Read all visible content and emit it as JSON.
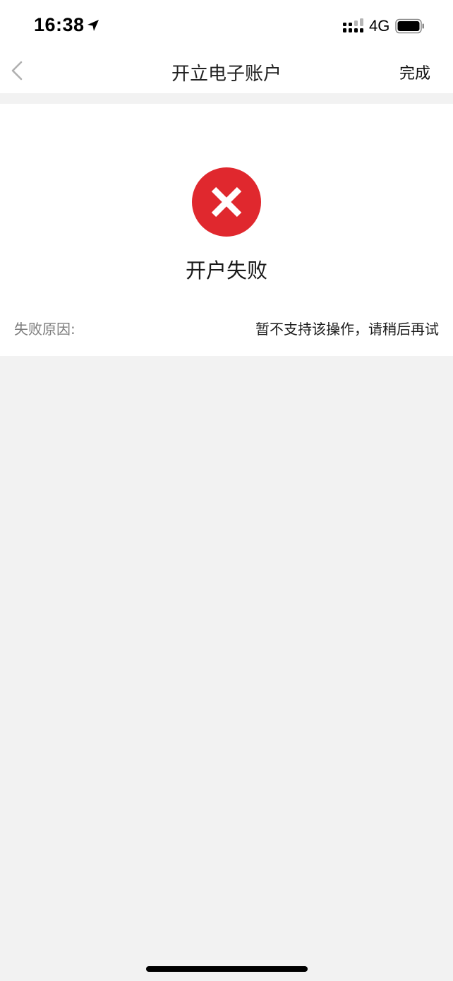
{
  "status_bar": {
    "time": "16:38",
    "network": "4G",
    "icons": [
      "location-arrow-icon",
      "cellular-signal-icon",
      "battery-icon"
    ]
  },
  "nav": {
    "title": "开立电子账户",
    "done_label": "完成",
    "back_icon": "chevron-left-icon"
  },
  "result": {
    "icon": "error-x-circle-icon",
    "title": "开户失败",
    "reason_label": "失败原因:",
    "reason_value": "暂不支持该操作，请稍后再试"
  },
  "colors": {
    "error_red": "#e0282e",
    "page_bg": "#f2f2f2",
    "card_bg": "#ffffff",
    "muted_text": "#7a7a7a"
  }
}
